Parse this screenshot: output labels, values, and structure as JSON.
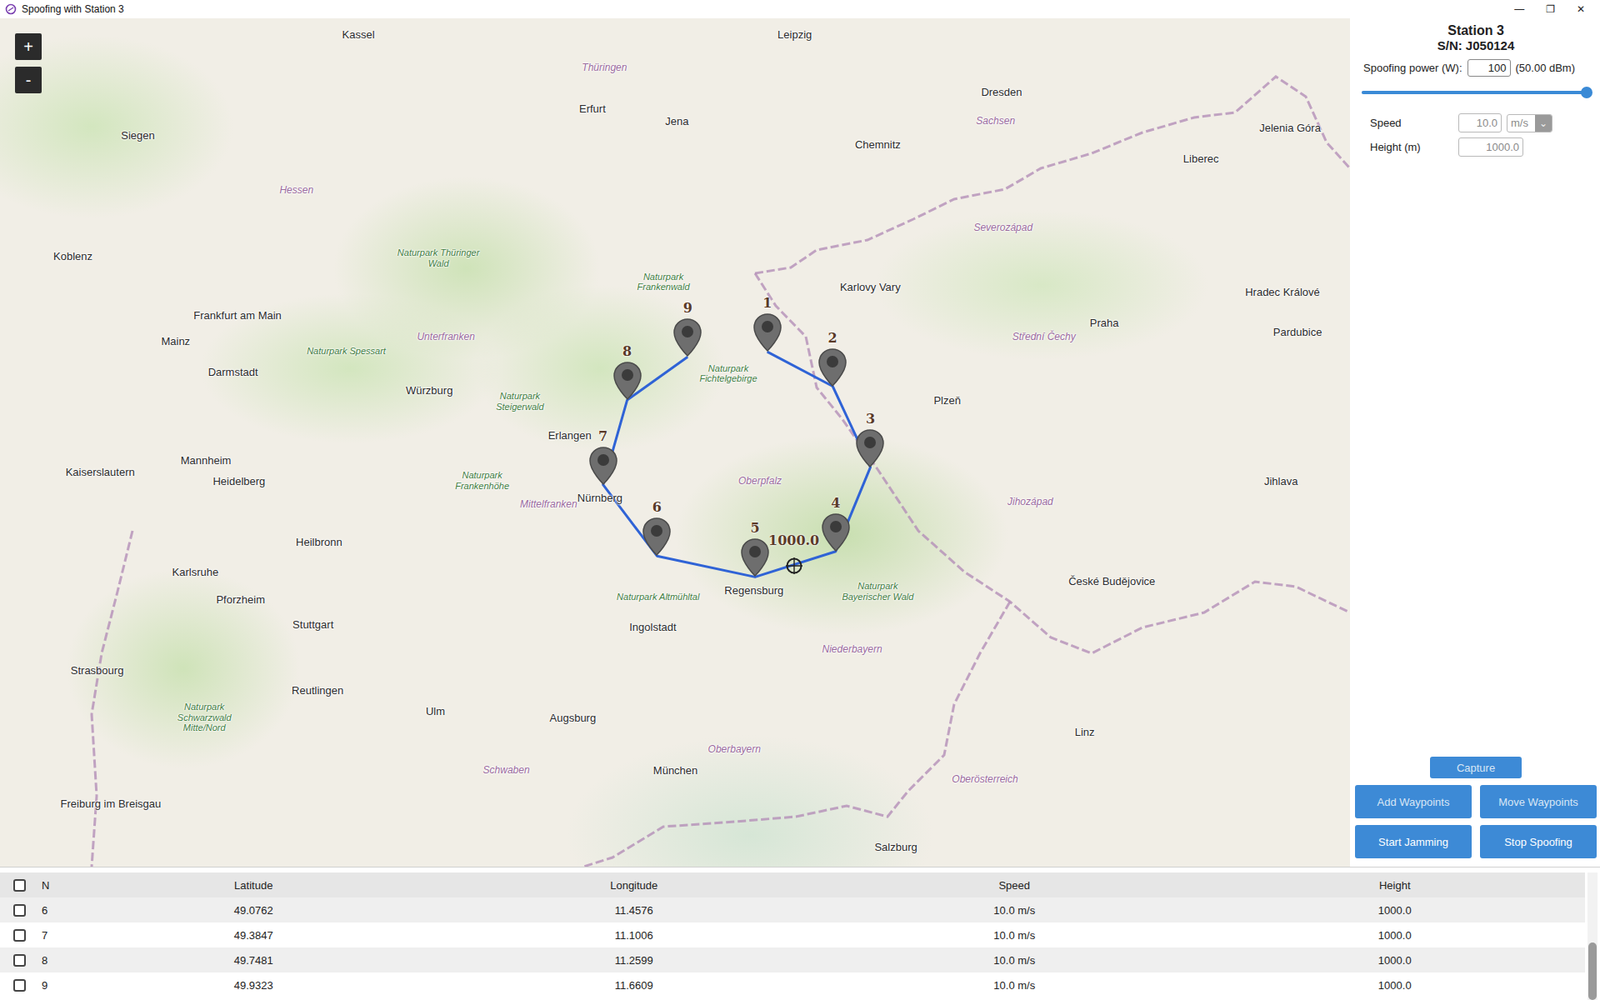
{
  "window": {
    "title": "Spoofing with Station 3",
    "controls": [
      "—",
      "❐",
      "✕"
    ]
  },
  "map": {
    "zoom_buttons": [
      "+",
      "-"
    ],
    "labels": [
      {
        "text": "Leipzig",
        "kind": "city",
        "lat": 51.29,
        "lon": 12.37
      },
      {
        "text": "Dresden",
        "kind": "city",
        "lat": 51.05,
        "lon": 13.74
      },
      {
        "text": "Chemnitz",
        "kind": "city",
        "lat": 50.83,
        "lon": 12.92
      },
      {
        "text": "Erfurt",
        "kind": "city",
        "lat": 50.98,
        "lon": 11.03
      },
      {
        "text": "Jena",
        "kind": "city",
        "lat": 50.93,
        "lon": 11.59
      },
      {
        "text": "Kassel",
        "kind": "city",
        "lat": 51.29,
        "lon": 9.48
      },
      {
        "text": "Siegen",
        "kind": "city",
        "lat": 50.87,
        "lon": 8.02
      },
      {
        "text": "Koblenz",
        "kind": "city",
        "lat": 50.36,
        "lon": 7.59
      },
      {
        "text": "Frankfurt am Main",
        "kind": "city",
        "lat": 50.11,
        "lon": 8.68
      },
      {
        "text": "Mainz",
        "kind": "city",
        "lat": 50.0,
        "lon": 8.27
      },
      {
        "text": "Darmstadt",
        "kind": "city",
        "lat": 49.87,
        "lon": 8.65
      },
      {
        "text": "Würzburg",
        "kind": "city",
        "lat": 49.79,
        "lon": 9.95
      },
      {
        "text": "Mannheim",
        "kind": "city",
        "lat": 49.49,
        "lon": 8.47
      },
      {
        "text": "Heidelberg",
        "kind": "city",
        "lat": 49.4,
        "lon": 8.69
      },
      {
        "text": "Kaiserslautern",
        "kind": "city",
        "lat": 49.44,
        "lon": 7.77
      },
      {
        "text": "Karlsruhe",
        "kind": "city",
        "lat": 49.01,
        "lon": 8.4
      },
      {
        "text": "Heilbronn",
        "kind": "city",
        "lat": 49.14,
        "lon": 9.22
      },
      {
        "text": "Pforzheim",
        "kind": "city",
        "lat": 48.89,
        "lon": 8.7
      },
      {
        "text": "Stuttgart",
        "kind": "city",
        "lat": 48.78,
        "lon": 9.18
      },
      {
        "text": "Strasbourg",
        "kind": "city",
        "lat": 48.58,
        "lon": 7.75
      },
      {
        "text": "Reutlingen",
        "kind": "city",
        "lat": 48.49,
        "lon": 9.21
      },
      {
        "text": "Ulm",
        "kind": "city",
        "lat": 48.4,
        "lon": 9.99
      },
      {
        "text": "Augsburg",
        "kind": "city",
        "lat": 48.37,
        "lon": 10.9
      },
      {
        "text": "München",
        "kind": "city",
        "lat": 48.14,
        "lon": 11.58
      },
      {
        "text": "Ingolstadt",
        "kind": "city",
        "lat": 48.77,
        "lon": 11.43
      },
      {
        "text": "Regensburg",
        "kind": "city",
        "lat": 48.93,
        "lon": 12.1
      },
      {
        "text": "Nürnberg",
        "kind": "city",
        "lat": 49.33,
        "lon": 11.08
      },
      {
        "text": "Erlangen",
        "kind": "city",
        "lat": 49.6,
        "lon": 10.88
      },
      {
        "text": "Karlovy Vary",
        "kind": "city",
        "lat": 50.23,
        "lon": 12.87
      },
      {
        "text": "Plzeň",
        "kind": "city",
        "lat": 49.75,
        "lon": 13.38
      },
      {
        "text": "Praha",
        "kind": "city",
        "lat": 50.08,
        "lon": 14.42
      },
      {
        "text": "Liberec",
        "kind": "city",
        "lat": 50.77,
        "lon": 15.06
      },
      {
        "text": "Jelenia Góra",
        "kind": "city",
        "lat": 50.9,
        "lon": 15.65
      },
      {
        "text": "Hradec Králové",
        "kind": "city",
        "lat": 50.21,
        "lon": 15.6
      },
      {
        "text": "Pardubice",
        "kind": "city",
        "lat": 50.04,
        "lon": 15.7
      },
      {
        "text": "Jihlava",
        "kind": "city",
        "lat": 49.4,
        "lon": 15.59
      },
      {
        "text": "České Budějovice",
        "kind": "city",
        "lat": 48.97,
        "lon": 14.47
      },
      {
        "text": "Linz",
        "kind": "city",
        "lat": 48.31,
        "lon": 14.29
      },
      {
        "text": "Salzburg",
        "kind": "city",
        "lat": 47.8,
        "lon": 13.04
      },
      {
        "text": "Freiburg im Breisgau",
        "kind": "city",
        "lat": 47.99,
        "lon": 7.84
      },
      {
        "text": "Sachsen",
        "kind": "region",
        "lat": 50.93,
        "lon": 13.7
      },
      {
        "text": "Thüringen",
        "kind": "region",
        "lat": 51.15,
        "lon": 11.11
      },
      {
        "text": "Hessen",
        "kind": "region",
        "lat": 50.64,
        "lon": 9.07
      },
      {
        "text": "Unterfranken",
        "kind": "region",
        "lat": 50.02,
        "lon": 10.06
      },
      {
        "text": "Oberpfalz",
        "kind": "region",
        "lat": 49.4,
        "lon": 12.14
      },
      {
        "text": "Mittelfranken",
        "kind": "region",
        "lat": 49.3,
        "lon": 10.74
      },
      {
        "text": "Niederbayern",
        "kind": "region",
        "lat": 48.67,
        "lon": 12.75
      },
      {
        "text": "Oberbayern",
        "kind": "region",
        "lat": 48.23,
        "lon": 11.97
      },
      {
        "text": "Schwaben",
        "kind": "region",
        "lat": 48.14,
        "lon": 10.46
      },
      {
        "text": "Oberösterreich",
        "kind": "region",
        "lat": 48.1,
        "lon": 13.63
      },
      {
        "text": "Severozápad",
        "kind": "region",
        "lat": 50.48,
        "lon": 13.75
      },
      {
        "text": "Střední Čechy",
        "kind": "region",
        "lat": 50.02,
        "lon": 14.02
      },
      {
        "text": "Jihozápad",
        "kind": "region",
        "lat": 49.31,
        "lon": 13.93
      },
      {
        "text": "Naturpark Fichtelgebirge",
        "kind": "park",
        "lat": 49.86,
        "lon": 11.93
      },
      {
        "text": "Naturpark Frankenwald",
        "kind": "park",
        "lat": 50.25,
        "lon": 11.5
      },
      {
        "text": "Naturpark Thüringer Wald",
        "kind": "park",
        "lat": 50.35,
        "lon": 10.01
      },
      {
        "text": "Naturpark Spessart",
        "kind": "park",
        "lat": 49.96,
        "lon": 9.4
      },
      {
        "text": "Naturpark Steigerwald",
        "kind": "park",
        "lat": 49.74,
        "lon": 10.55
      },
      {
        "text": "Naturpark Frankenhöhe",
        "kind": "park",
        "lat": 49.4,
        "lon": 10.3
      },
      {
        "text": "Naturpark Altmühltal",
        "kind": "park",
        "lat": 48.9,
        "lon": 11.465
      },
      {
        "text": "Naturpark Bayerischer Wald",
        "kind": "park",
        "lat": 48.92,
        "lon": 12.92
      },
      {
        "text": "Naturpark Schwarzwald Mitte/Nord",
        "kind": "park",
        "lat": 48.37,
        "lon": 8.46
      }
    ],
    "waypoints": [
      {
        "label": "1",
        "lat": 49.954,
        "lon": 12.188
      },
      {
        "label": "2",
        "lat": 49.807,
        "lon": 12.621
      },
      {
        "label": "3",
        "lat": 49.46,
        "lon": 12.871
      },
      {
        "label": "4",
        "lat": 49.096,
        "lon": 12.641
      },
      {
        "label": "5",
        "lat": 48.985,
        "lon": 12.107
      },
      {
        "label": "6",
        "lat": 49.0762,
        "lon": 11.4576
      },
      {
        "label": "7",
        "lat": 49.3847,
        "lon": 11.1006
      },
      {
        "label": "8",
        "lat": 49.7481,
        "lon": 11.2599
      },
      {
        "label": "9",
        "lat": 49.9323,
        "lon": 11.6609
      }
    ],
    "current": {
      "label": "1000.0",
      "lat": 49.033,
      "lon": 12.364
    }
  },
  "panel": {
    "title": "Station 3",
    "serial": "S/N: J050124",
    "power": {
      "label": "Spoofing power (W):",
      "value": "100",
      "reading": "(50.00 dBm)",
      "level": 1.0
    },
    "speed": {
      "label": "Speed",
      "value": "10.0",
      "unit": "m/s",
      "chevron": "⌄",
      "disabled": true
    },
    "height": {
      "label": "Height (m)",
      "value": "1000.0",
      "disabled": true
    },
    "capture": {
      "label": "Capture",
      "disabled": true
    },
    "buttons": [
      {
        "label": "Add Waypoints",
        "disabled": true
      },
      {
        "label": "Move Waypoints",
        "disabled": true
      },
      {
        "label": "Start Jamming",
        "disabled": false
      },
      {
        "label": "Stop Spoofing",
        "disabled": false
      }
    ]
  },
  "table": {
    "columns": [
      "N",
      "Latitude",
      "Longitude",
      "Speed",
      "Height"
    ],
    "header_checked": false,
    "rows": [
      {
        "n": "6",
        "lat": "49.0762",
        "lon": "11.4576",
        "speed": "10.0 m/s",
        "height": "1000.0",
        "checked": false
      },
      {
        "n": "7",
        "lat": "49.3847",
        "lon": "11.1006",
        "speed": "10.0 m/s",
        "height": "1000.0",
        "checked": false
      },
      {
        "n": "8",
        "lat": "49.7481",
        "lon": "11.2599",
        "speed": "10.0 m/s",
        "height": "1000.0",
        "checked": false
      },
      {
        "n": "9",
        "lat": "49.9323",
        "lon": "11.6609",
        "speed": "10.0 m/s",
        "height": "1000.0",
        "checked": false
      }
    ],
    "scrollbar": {
      "level": 1.0
    }
  }
}
